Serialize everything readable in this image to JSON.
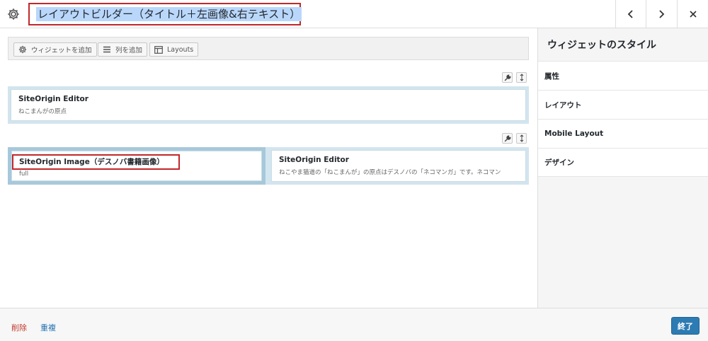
{
  "header": {
    "title": "レイアウトビルダー（タイトル＋左画像&右テキスト）",
    "prev_icon": "chevron-left-icon",
    "next_icon": "chevron-right-icon",
    "close_icon": "close-icon",
    "settings_icon": "gear-icon"
  },
  "toolbar": {
    "add_widget": "ウィジェットを追加",
    "add_row": "列を追加",
    "layouts": "Layouts"
  },
  "rows": [
    {
      "cells": [
        {
          "widget_title": "SiteOrigin Editor",
          "widget_desc": "ねこまんがの原点"
        }
      ]
    },
    {
      "cells": [
        {
          "widget_title": "SiteOrigin Image（デスノバ書籍画像）",
          "widget_desc": "full"
        },
        {
          "widget_title": "SiteOrigin Editor",
          "widget_desc": "ねこやま猫道の「ねこまんが」の原点はデスノバの「ネコマンガ」です。ネコマン"
        }
      ]
    }
  ],
  "sidebar": {
    "title": "ウィジェットのスタイル",
    "items": [
      "属性",
      "レイアウト",
      "Mobile Layout",
      "デザイン"
    ]
  },
  "footer": {
    "delete": "削除",
    "duplicate": "重複",
    "done": "終了"
  },
  "colors": {
    "accent": "#2d7bb3",
    "delete_link": "#c0392b",
    "duplicate_link": "#2271b1",
    "highlight_border": "#c0282b",
    "row_bg": "#d3e5ee",
    "selected_cell": "#a7c8da"
  }
}
